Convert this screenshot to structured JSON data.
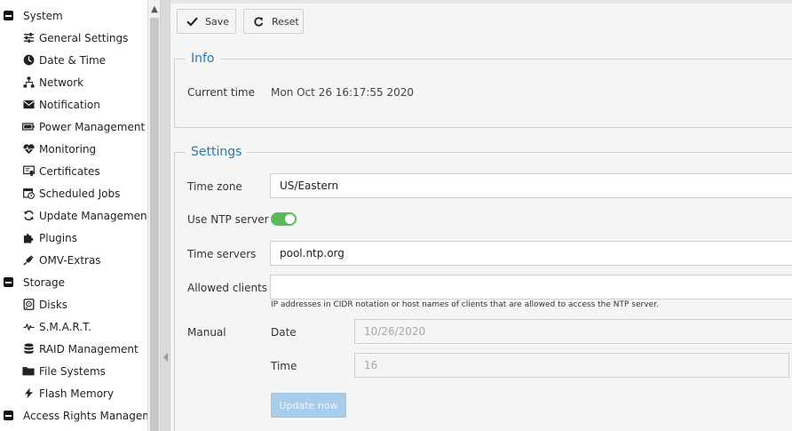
{
  "sidebar": {
    "items": [
      {
        "label": "System",
        "type": "group",
        "icon": "collapse-icon"
      },
      {
        "label": "General Settings",
        "type": "leaf",
        "icon": "sliders-icon"
      },
      {
        "label": "Date & Time",
        "type": "leaf",
        "icon": "clock-icon"
      },
      {
        "label": "Network",
        "type": "leaf",
        "icon": "network-icon"
      },
      {
        "label": "Notification",
        "type": "leaf",
        "icon": "envelope-icon"
      },
      {
        "label": "Power Management",
        "type": "leaf",
        "icon": "battery-icon"
      },
      {
        "label": "Monitoring",
        "type": "leaf",
        "icon": "heartbeat-icon"
      },
      {
        "label": "Certificates",
        "type": "leaf",
        "icon": "certificate-icon"
      },
      {
        "label": "Scheduled Jobs",
        "type": "leaf",
        "icon": "calendar-clock-icon"
      },
      {
        "label": "Update Management",
        "type": "leaf",
        "icon": "refresh-icon"
      },
      {
        "label": "Plugins",
        "type": "leaf",
        "icon": "puzzle-icon"
      },
      {
        "label": "OMV-Extras",
        "type": "leaf",
        "icon": "plug-icon"
      },
      {
        "label": "Storage",
        "type": "group",
        "icon": "collapse-icon"
      },
      {
        "label": "Disks",
        "type": "leaf",
        "icon": "disk-icon"
      },
      {
        "label": "S.M.A.R.T.",
        "type": "leaf",
        "icon": "pulse-icon"
      },
      {
        "label": "RAID Management",
        "type": "leaf",
        "icon": "database-icon"
      },
      {
        "label": "File Systems",
        "type": "leaf",
        "icon": "folder-icon"
      },
      {
        "label": "Flash Memory",
        "type": "leaf",
        "icon": "flash-icon"
      },
      {
        "label": "Access Rights Management",
        "type": "group",
        "icon": "collapse-icon"
      }
    ]
  },
  "toolbar": {
    "save_label": "Save",
    "reset_label": "Reset"
  },
  "info": {
    "legend": "Info",
    "current_time_label": "Current time",
    "current_time_value": "Mon Oct 26 16:17:55 2020"
  },
  "settings": {
    "legend": "Settings",
    "timezone_label": "Time zone",
    "timezone_value": "US/Eastern",
    "ntp_label": "Use NTP server",
    "ntp_enabled": true,
    "time_servers_label": "Time servers",
    "time_servers_value": "pool.ntp.org",
    "allowed_clients_label": "Allowed clients",
    "allowed_clients_value": "",
    "allowed_clients_hint": "IP addresses in CIDR notation or host names of clients that are allowed to access the NTP server.",
    "manual_label": "Manual",
    "date_label": "Date",
    "date_value": "10/26/2020",
    "time_label": "Time",
    "time_value": "16",
    "update_now_label": "Update now"
  },
  "colors": {
    "accent": "#2a79b2",
    "toggle_on": "#5cb85c",
    "update_button": "#a7ccec"
  }
}
